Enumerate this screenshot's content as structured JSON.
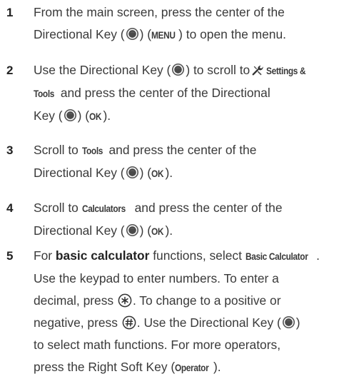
{
  "steps": [
    {
      "number": "1",
      "l1": "From the main screen, press the center of the",
      "l2a": "Directional Key (",
      "l2b": ") (",
      "menu_label": "MENU",
      "l2c": ") to open the menu."
    },
    {
      "number": "2",
      "l1a": "Use the Directional Key (",
      "l1b": ") to scroll to",
      "settings_a": "Settings &",
      "settings_b": "Tools",
      "l2c": " and press the center of the Directional",
      "l3a": "Key (",
      "l3b": ") (",
      "ok_label": "OK",
      "l3c": ")."
    },
    {
      "number": "3",
      "l1a": "Scroll to ",
      "tools_label": "Tools",
      "l1b": " and press the center of the",
      "l2a": "Directional Key (",
      "l2b": ") (",
      "ok_label": "OK",
      "l2c": ")."
    },
    {
      "number": "4",
      "l1a": "Scroll to ",
      "calculators_label": "Calculators",
      "l1b": " and press the center of the",
      "l2a": "Directional Key (",
      "l2b": ") (",
      "ok_label": "OK",
      "l2c": ")."
    },
    {
      "number": "5",
      "l1a": "For ",
      "basic_bold": "basic calculator",
      "l1b": " functions, select ",
      "basic_label": "Basic Calculator",
      "l1c": ".",
      "l2": "Use the keypad to enter numbers. To enter a",
      "l3a": "decimal, press ",
      "l3b": ". To change to a positive or",
      "l4a": "negative, press ",
      "l4b": ". Use the Directional Key (",
      "l4c": ")",
      "l5": "to select math functions. For more operators,",
      "l6a": "press the Right Soft Key (",
      "operator_label": "Operator",
      "l6b": ")."
    }
  ],
  "icons": {
    "directional_key": "directional-key-icon",
    "star_key": "star-key-icon",
    "pound_key": "pound-key-icon",
    "settings_tools": "wrench-icon"
  }
}
